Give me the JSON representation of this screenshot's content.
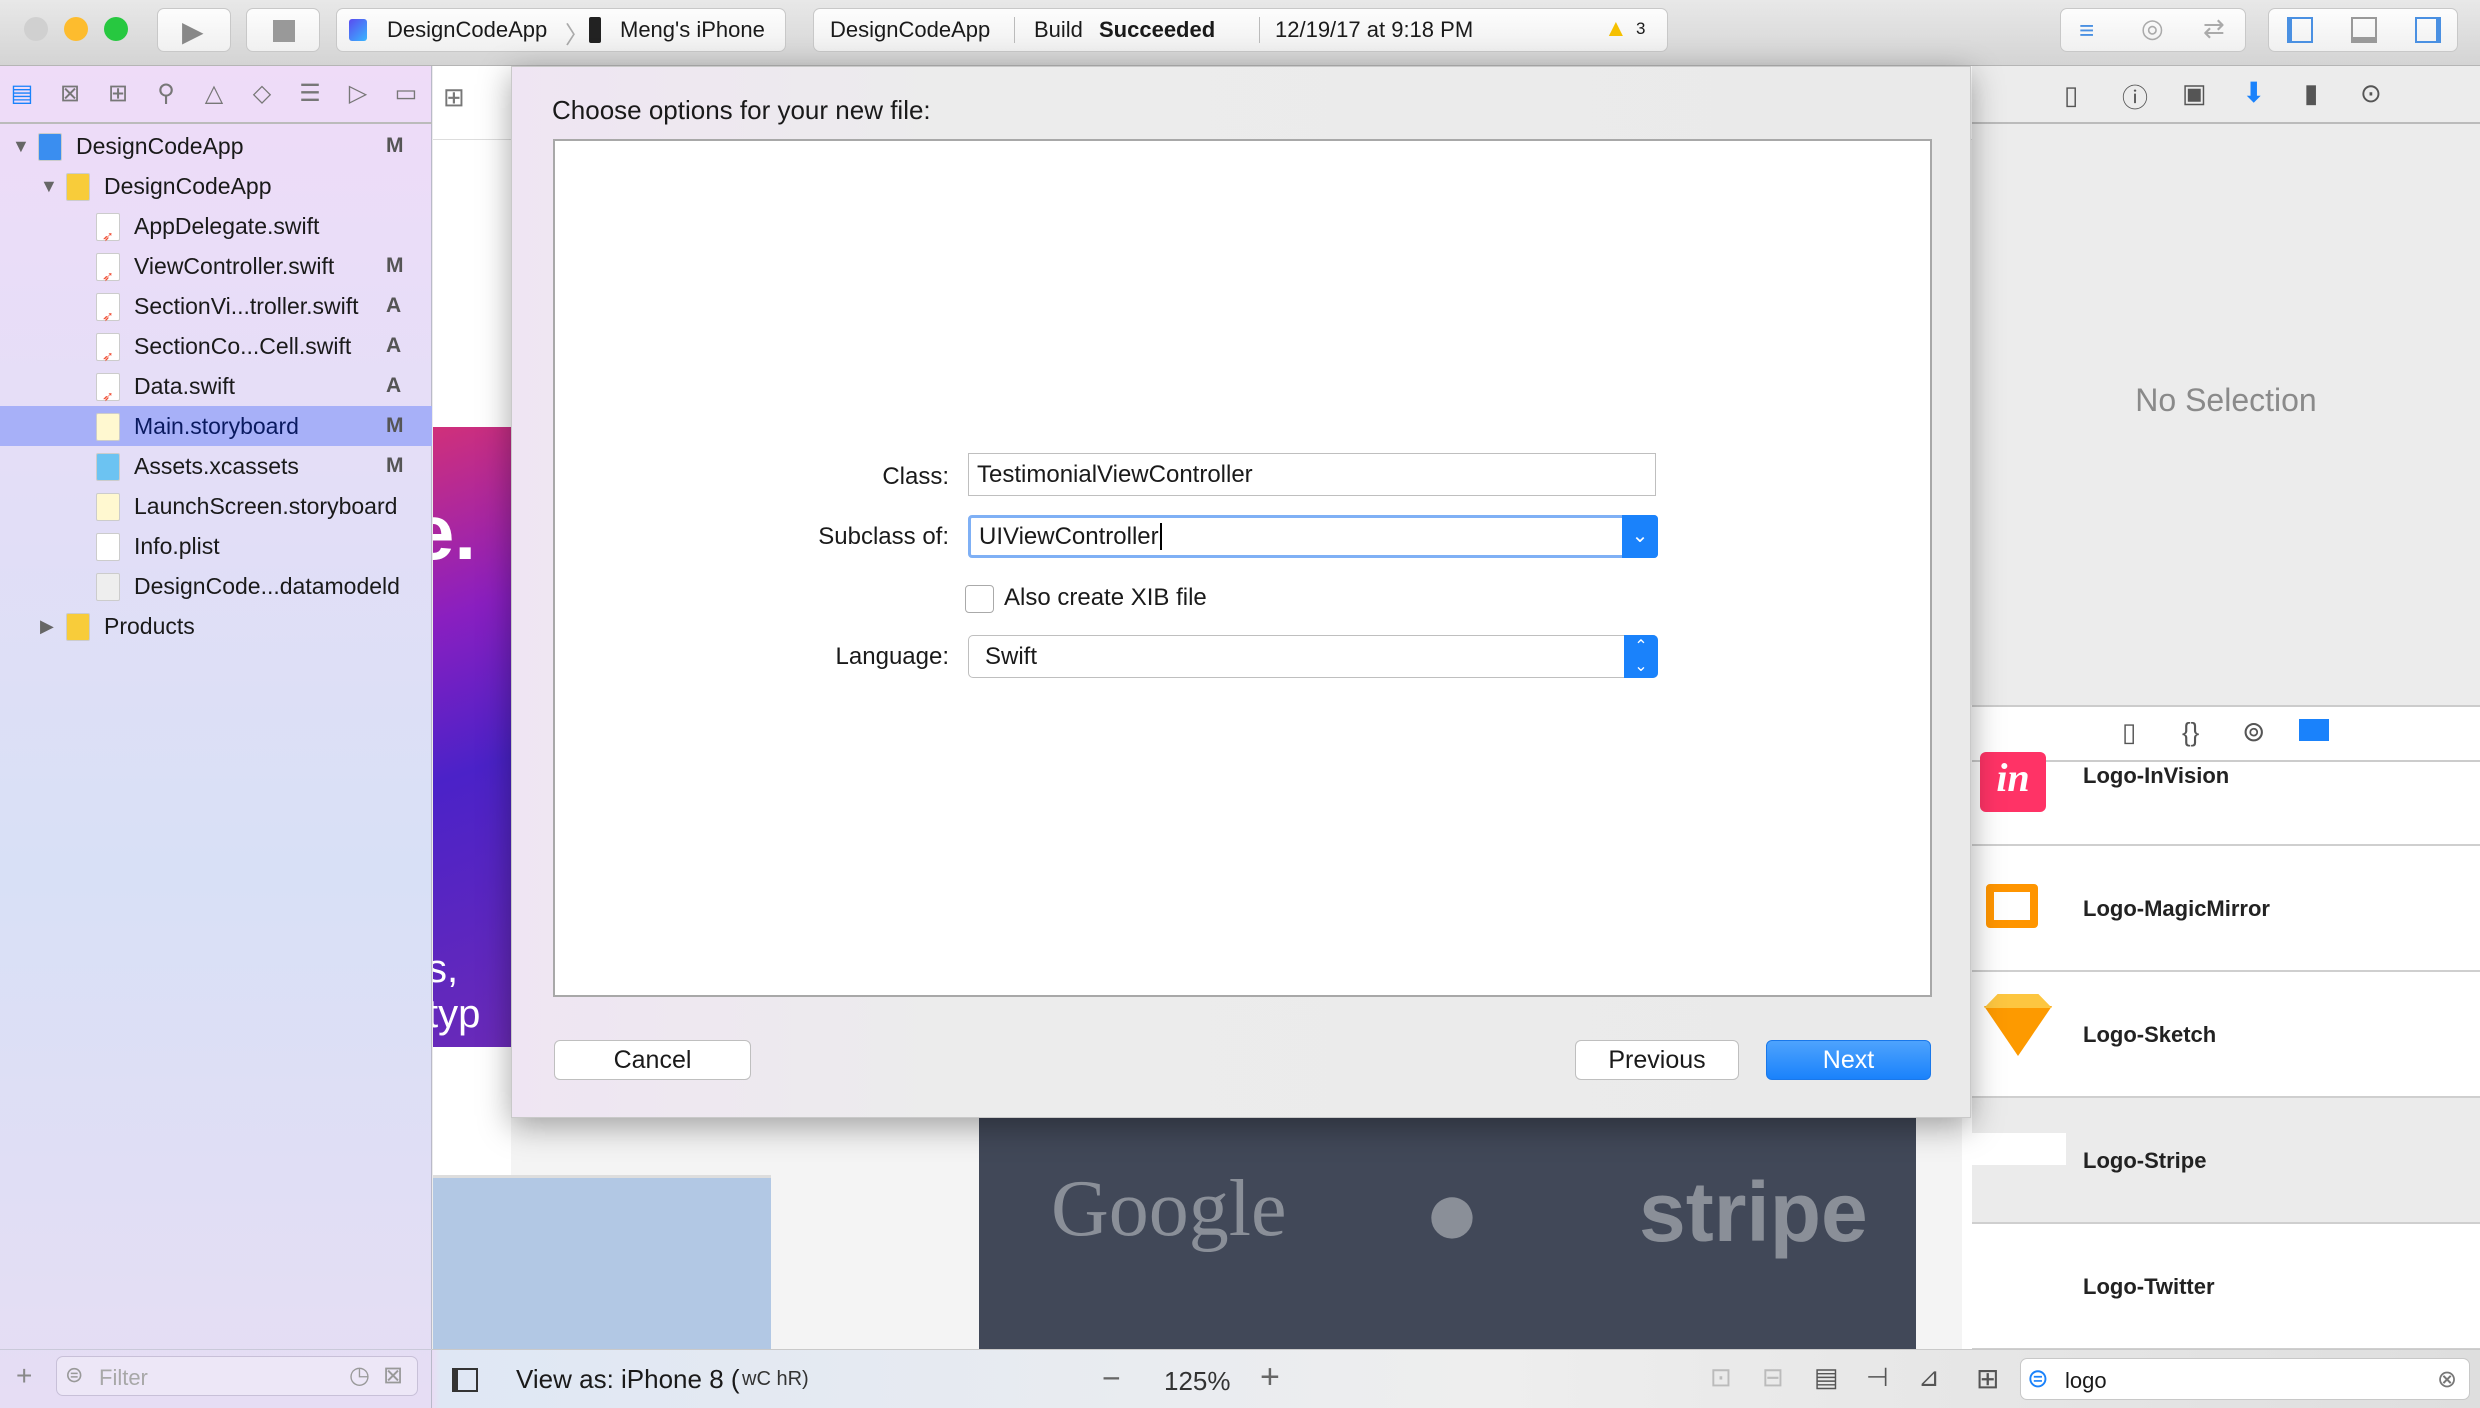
{
  "toolbar": {
    "scheme": "DesignCodeApp",
    "device": "Meng's iPhone",
    "status_project": "DesignCodeApp",
    "status_build_prefix": "Build",
    "status_build_result": "Succeeded",
    "status_time": "12/19/17 at 9:18 PM",
    "warning_count": "3"
  },
  "navigator": {
    "items": [
      {
        "label": "DesignCodeApp",
        "status": "M",
        "type": "project"
      },
      {
        "label": "DesignCodeApp",
        "status": "",
        "type": "folder"
      },
      {
        "label": "AppDelegate.swift",
        "status": "",
        "type": "swift"
      },
      {
        "label": "ViewController.swift",
        "status": "M",
        "type": "swift"
      },
      {
        "label": "SectionVi...troller.swift",
        "status": "A",
        "type": "swift"
      },
      {
        "label": "SectionCo...Cell.swift",
        "status": "A",
        "type": "swift"
      },
      {
        "label": "Data.swift",
        "status": "A",
        "type": "swift"
      },
      {
        "label": "Main.storyboard",
        "status": "M",
        "type": "storyboard",
        "selected": true
      },
      {
        "label": "Assets.xcassets",
        "status": "M",
        "type": "assets"
      },
      {
        "label": "LaunchScreen.storyboard",
        "status": "",
        "type": "storyboard"
      },
      {
        "label": "Info.plist",
        "status": "",
        "type": "plist"
      },
      {
        "label": "DesignCode...datamodeld",
        "status": "",
        "type": "datamodel"
      },
      {
        "label": "Products",
        "status": "",
        "type": "folder"
      }
    ],
    "filter_placeholder": "Filter"
  },
  "canvas": {
    "fragment_title": "e.",
    "fragment_sub": "s, typ",
    "logos": [
      "Google",
      "stripe"
    ]
  },
  "dialog": {
    "title": "Choose options for your new file:",
    "class_label": "Class:",
    "class_value": "TestimonialViewController",
    "subclass_label": "Subclass of:",
    "subclass_value": "UIViewController",
    "xib_label": "Also create XIB file",
    "xib_checked": false,
    "language_label": "Language:",
    "language_value": "Swift",
    "cancel": "Cancel",
    "previous": "Previous",
    "next": "Next"
  },
  "inspector": {
    "empty": "No Selection"
  },
  "library": {
    "items": [
      "Logo-InVision",
      "Logo-MagicMirror",
      "Logo-Sketch",
      "Logo-Stripe",
      "Logo-Twitter"
    ],
    "selected": "Logo-Stripe",
    "search_value": "logo"
  },
  "bottom": {
    "view_as": "View as: iPhone 8 (",
    "size_class": "wC hR)",
    "zoom": "125%"
  },
  "colors": {
    "accent": "#1a82fb",
    "selection": "#a7b0f8",
    "warning": "#f5c000"
  }
}
